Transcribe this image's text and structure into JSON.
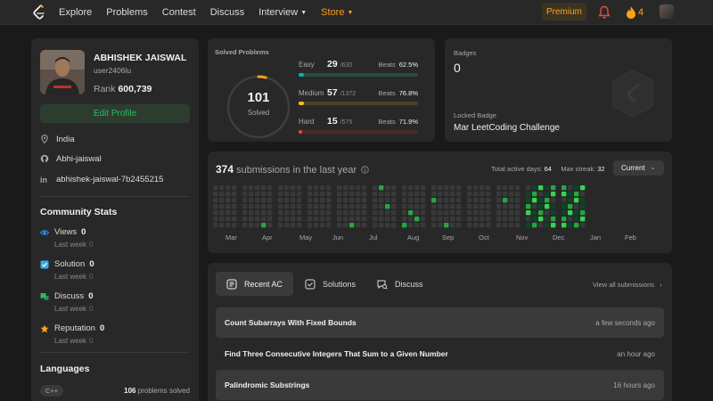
{
  "nav": {
    "links": [
      "Explore",
      "Problems",
      "Contest",
      "Discuss",
      "Interview",
      "Store"
    ],
    "premium": "Premium",
    "streak": "4"
  },
  "profile": {
    "name": "ABHISHEK JAISWAL",
    "handle": "user2406lu",
    "rank_label": "Rank",
    "rank_value": "600,739",
    "edit_label": "Edit Profile",
    "location": "India",
    "github": "Abhi-jaiswal",
    "linkedin": "abhishek-jaiswal-7b2455215"
  },
  "community": {
    "title": "Community Stats",
    "items": [
      {
        "label": "Views",
        "value": "0",
        "sub": "Last week",
        "sub_value": "0",
        "color": "#2a8af6"
      },
      {
        "label": "Solution",
        "value": "0",
        "sub": "Last week",
        "sub_value": "0",
        "color": "#3ea9e6"
      },
      {
        "label": "Discuss",
        "value": "0",
        "sub": "Last week",
        "sub_value": "0",
        "color": "#2cbb5d"
      },
      {
        "label": "Reputation",
        "value": "0",
        "sub": "Last week",
        "sub_value": "0",
        "color": "#ffa116"
      }
    ]
  },
  "languages": {
    "title": "Languages",
    "items": [
      {
        "name": "C++",
        "count": "106",
        "suffix": "problems solved"
      }
    ]
  },
  "solved": {
    "title": "Solved Problems",
    "total": "101",
    "total_label": "Solved",
    "ring_total": 2577,
    "beats_label": "Beats",
    "difficulties": [
      {
        "level": "Easy",
        "solved": "29",
        "total": "/630",
        "beats": "62.5%",
        "color": "#00b8a3",
        "track": "#2a4a44",
        "fraction": 0.046
      },
      {
        "level": "Medium",
        "solved": "57",
        "total": "/1372",
        "beats": "76.8%",
        "color": "#ffc01e",
        "track": "#4a4226",
        "fraction": 0.042
      },
      {
        "level": "Hard",
        "solved": "15",
        "total": "/575",
        "beats": "71.9%",
        "color": "#ef4743",
        "track": "#4a2a2a",
        "fraction": 0.026
      }
    ]
  },
  "badges": {
    "label": "Badges",
    "count": "0",
    "locked_label": "Locked Badge",
    "locked_name": "Mar LeetCoding Challenge"
  },
  "submissions": {
    "count": "374",
    "suffix": "submissions in the last year",
    "active_label": "Total active days:",
    "active_value": "64",
    "streak_label": "Max streak:",
    "streak_value": "32",
    "dropdown": "Current",
    "months": [
      "Mar",
      "Apr",
      "May",
      "Jun",
      "Jul",
      "Aug",
      "Sep",
      "Oct",
      "Nov",
      "Dec",
      "Jan",
      "Feb"
    ]
  },
  "recent": {
    "tabs": [
      "Recent AC",
      "Solutions",
      "Discuss"
    ],
    "view_all": "View all submissions",
    "items": [
      {
        "title": "Count Subarrays With Fixed Bounds",
        "when": "a few seconds ago"
      },
      {
        "title": "Find Three Consecutive Integers That Sum to a Given Number",
        "when": "an hour ago"
      },
      {
        "title": "Palindromic Substrings",
        "when": "16 hours ago"
      }
    ]
  }
}
